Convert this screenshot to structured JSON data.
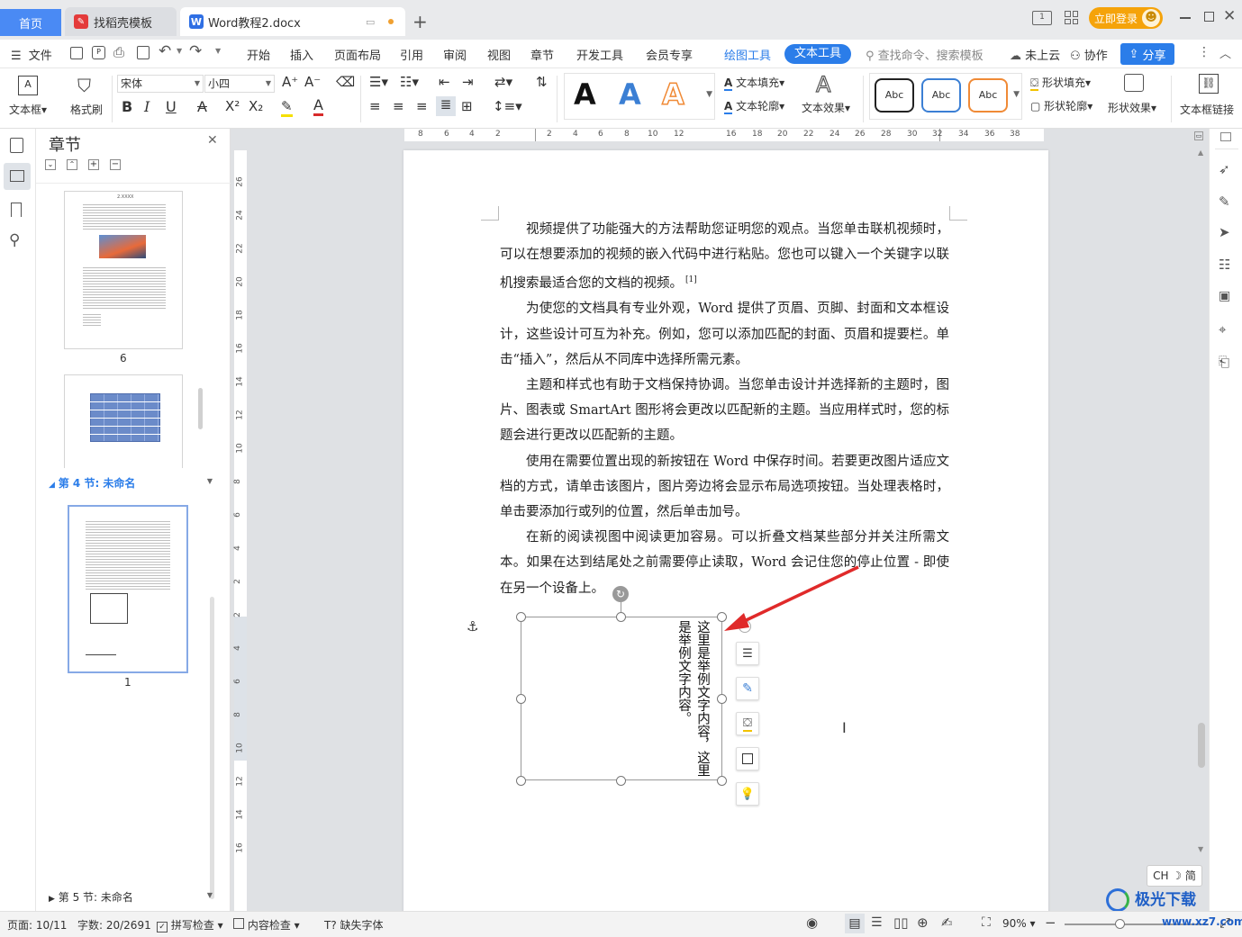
{
  "tabs": {
    "home": "首页",
    "template": "找稻壳模板",
    "doc": "Word教程2.docx",
    "new_tab": "+"
  },
  "window": {
    "login": "立即登录"
  },
  "menu": {
    "file": "文件",
    "items": [
      "开始",
      "插入",
      "页面布局",
      "引用",
      "审阅",
      "视图",
      "章节",
      "开发工具",
      "会员专享"
    ],
    "draw_tools": "绘图工具",
    "text_tools": "文本工具",
    "search": "查找命令、搜索模板",
    "cloud": "未上云",
    "collab": "协作",
    "share": "分享"
  },
  "ribbon": {
    "textbox": "文本框",
    "format_painter": "格式刷",
    "font_name": "宋体",
    "font_size": "小四",
    "style_letters": [
      "A",
      "A",
      "A"
    ],
    "text_fill": "文本填充",
    "text_outline": "文本轮廓",
    "text_effect": "文本效果",
    "shape_styles": [
      "Abc",
      "Abc",
      "Abc"
    ],
    "shape_fill": "形状填充",
    "shape_outline": "形状轮廓",
    "shape_effect": "形状效果",
    "textbox_link": "文本框链接",
    "colors": {
      "style_black": "#111111",
      "style_blue": "#3b7fd4",
      "style_orange": "#f08a36",
      "accent": "#2b7de9"
    }
  },
  "nav": {
    "title": "章节",
    "pages": [
      {
        "label": "6"
      },
      {
        "label": ""
      },
      {
        "label": "1"
      }
    ],
    "section4": "第 4 节: 未命名",
    "section5": "第 5 节: 未命名",
    "thumb_title": "2.XXXX"
  },
  "ruler": {
    "h_ticks": [
      "8",
      "6",
      "4",
      "2",
      "2",
      "4",
      "6",
      "8",
      "10",
      "12",
      "16",
      "18",
      "20",
      "22",
      "24",
      "26",
      "28",
      "30",
      "32",
      "34",
      "36",
      "38"
    ],
    "v_ticks": [
      "26",
      "24",
      "22",
      "20",
      "18",
      "16",
      "14",
      "12",
      "10",
      "8",
      "6",
      "4",
      "2",
      "2",
      "4",
      "6",
      "8",
      "10",
      "12",
      "14",
      "16"
    ]
  },
  "document": {
    "paragraphs": [
      "视频提供了功能强大的方法帮助您证明您的观点。当您单击联机视频时，可以在想要添加的视频的嵌入代码中进行粘贴。您也可以键入一个关键字以联机搜索最适合您的文档的视频。",
      "为使您的文档具有专业外观，Word 提供了页眉、页脚、封面和文本框设计，这些设计可互为补充。例如，您可以添加匹配的封面、页眉和提要栏。单击“插入”，然后从不同库中选择所需元素。",
      "主题和样式也有助于文档保持协调。当您单击设计并选择新的主题时，图片、图表或 SmartArt 图形将会更改以匹配新的主题。当应用样式时，您的标题会进行更改以匹配新的主题。",
      "使用在需要位置出现的新按钮在 Word 中保存时间。若要更改图片适应文档的方式，请单击该图片，图片旁边将会显示布局选项按钮。当处理表格时，单击要添加行或列的位置，然后单击加号。",
      "在新的阅读视图中阅读更加容易。可以折叠文档某些部分并关注所需文本。如果在达到结尾处之前需要停止读取，Word 会记住您的停止位置 - 即使在另一个设备上。"
    ],
    "footnote_ref": "[1]",
    "textbox_col1": "这里是举例文字内容，这里",
    "textbox_col2": "是举例文字内容。",
    "arrow_color": "#e02a2a"
  },
  "ime": {
    "label": "CH ☽ 简"
  },
  "status": {
    "page": "页面: 10/11",
    "words": "字数: 20/2691",
    "spell": "拼写检查",
    "content": "内容检查",
    "missing_font": "缺失字体",
    "zoom": "90%"
  },
  "watermark": {
    "text": "极光下载站",
    "url": "www.xz7.com"
  }
}
